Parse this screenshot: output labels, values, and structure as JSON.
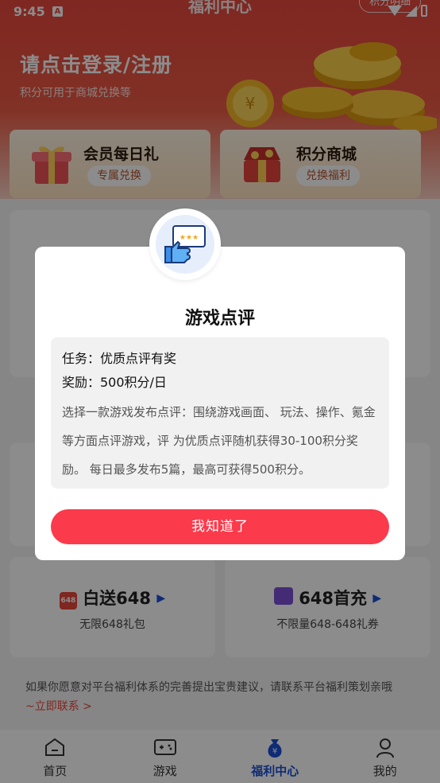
{
  "status_bar": {
    "time": "9:45",
    "notif_letter": "A"
  },
  "header": {
    "title": "福利中心",
    "points_detail": "积分明细"
  },
  "login": {
    "title": "请点击登录/注册",
    "subtitle": "积分可用于商城兑换等"
  },
  "features": [
    {
      "title": "会员每日礼",
      "badge": "专属兑换"
    },
    {
      "title": "积分商城",
      "badge": "兑换福利"
    }
  ],
  "rewards": [
    {
      "title": "白送648",
      "subtitle": "无限648礼包",
      "tag": "648",
      "color": "#e8473d"
    },
    {
      "title": "648首充",
      "subtitle": "不限量648-648礼券",
      "color": "#7b4fd8"
    }
  ],
  "suggest": {
    "text": "如果你愿意对平台福利体系的完善提出宝贵建议，请联系平台福利策划亲哦",
    "link": "~立即联系 >"
  },
  "tabbar": [
    {
      "label": "首页",
      "active": false
    },
    {
      "label": "游戏",
      "active": false
    },
    {
      "label": "福利中心",
      "active": true
    },
    {
      "label": "我的",
      "active": false
    }
  ],
  "modal": {
    "title": "游戏点评",
    "task": "任务：优质点评有奖",
    "reward": "奖励：500积分/日",
    "description": "选择一款游戏发布点评：围绕游戏画面、 玩法、操作、氪金等方面点评游戏，评 为优质点评随机获得30-100积分奖励。 每日最多发布5篇，最高可获得500积分。",
    "ok_label": "我知道了"
  },
  "colors": {
    "brand_red": "#e8473d",
    "button_red": "#fb3a4b",
    "active_tab": "#1a4fd6"
  }
}
